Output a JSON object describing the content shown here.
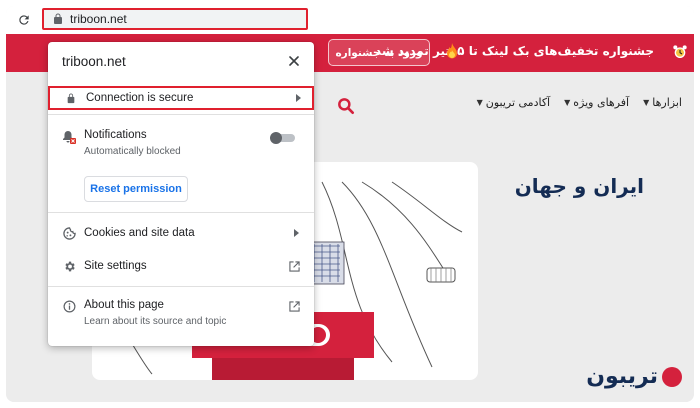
{
  "browser": {
    "url": "triboon.net",
    "reload_icon": "reload-icon",
    "lock_icon": "lock-icon"
  },
  "site": {
    "banner_text": "جشنواره تخفیف‌های بک لینک تا ۱۵تیر تمدید شد",
    "banner_button": "ورود به جشنواره",
    "nav": [
      {
        "label": "ابزارها"
      },
      {
        "label": "آفرهای ویژه"
      },
      {
        "label": "آکادمی تریبون"
      }
    ],
    "hero_title": "ایران و جهان",
    "logo_text": "تریبون",
    "colors": {
      "brand_red": "#d4213d",
      "navy": "#142c54"
    }
  },
  "popup": {
    "title": "triboon.net",
    "secure_label": "Connection is secure",
    "notifications_label": "Notifications",
    "notifications_sub": "Automatically blocked",
    "notifications_enabled": false,
    "reset_button": "Reset permission",
    "cookies_label": "Cookies and site data",
    "site_settings_label": "Site settings",
    "about_label": "About this page",
    "about_sub": "Learn about its source and topic"
  }
}
